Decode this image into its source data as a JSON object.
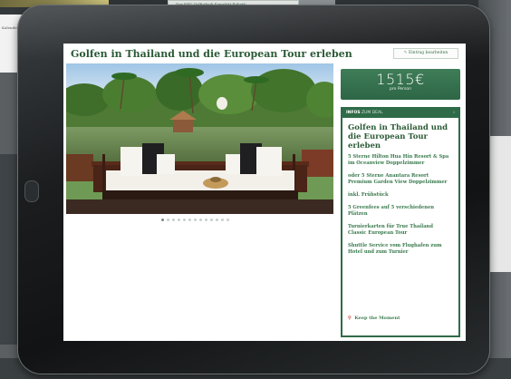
{
  "background": {
    "banner_text": "Der NEU Golfurlaub Komplett Rabatt!",
    "left_card_text": "Kalender"
  },
  "page": {
    "title": "Golfen in Thailand und die European Tour erleben",
    "edit_button": {
      "icon": "pencil-icon",
      "label": "Eintrag bearbeiten"
    }
  },
  "carousel": {
    "total_dots": 13,
    "active_index": 0
  },
  "price": {
    "value": "1515€",
    "unit": "pro Person"
  },
  "info_panel": {
    "header_tag": "INFOS",
    "header_sub": "ZUM DEAL",
    "header_caret": "›",
    "title": "Golfen in Thailand und die European Tour erleben",
    "items": [
      "5 Sterne Hilton Hua Hin Resort & Spa im Oceanview Doppelzimmer",
      "oder 5 Sterne Anantara Resort Premium Garden View Doppelzimmer",
      "inkl. Frühstück",
      "5 Greenfees auf 5 verschiedenen Plätzen",
      "Turnierkarten für True Thailand Classic European Tour",
      "Shuttle Service vom Flughafen zum Hotel und zum Turnier"
    ],
    "keep_label": "Keep the Moment",
    "keep_icon": "map-pin-icon"
  },
  "colors": {
    "accent": "#2f6b48",
    "title": "#2a5a36",
    "pin": "#d0453b"
  }
}
